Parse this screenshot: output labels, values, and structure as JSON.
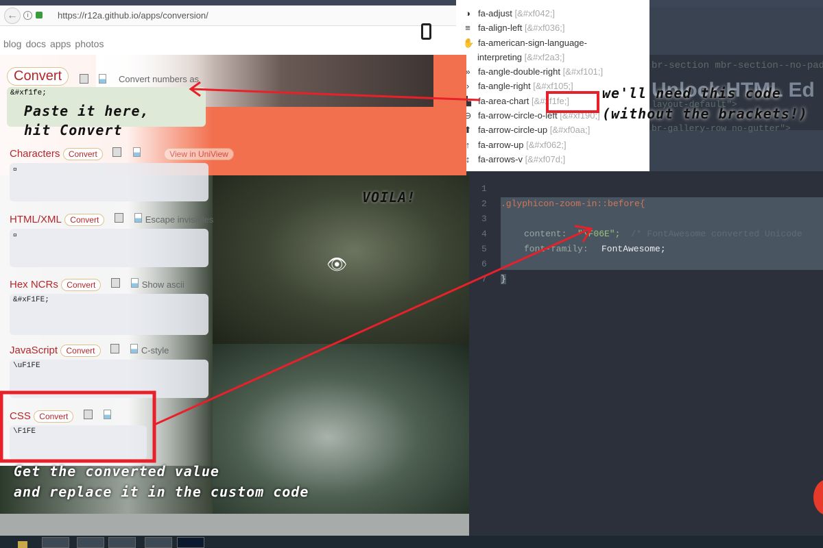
{
  "browser": {
    "url": "https://r12a.github.io/apps/conversion/"
  },
  "nav": [
    "blog",
    "docs",
    "apps",
    "photos"
  ],
  "top_convert": {
    "label": "Convert",
    "option": "Convert numbers as",
    "input_value": "&#xf1fe;"
  },
  "sections": [
    {
      "title": "Characters",
      "button": "Convert",
      "option": "View in UniView",
      "value": ""
    },
    {
      "title": "HTML/XML",
      "button": "Convert",
      "option": "Escape invisibles",
      "value": ""
    },
    {
      "title": "Hex NCRs",
      "button": "Convert",
      "option": "Show ascii",
      "value": "&#xF1FE;"
    },
    {
      "title": "JavaScript",
      "button": "Convert",
      "option": "C-style",
      "value": "\\uF1FE"
    },
    {
      "title": "CSS",
      "button": "Convert",
      "option": "",
      "value": "\\F1FE"
    }
  ],
  "icon_list": [
    {
      "icon": "adjust-icon",
      "glyph": "◑",
      "name": "fa-adjust",
      "code": "[&#xf042;]"
    },
    {
      "icon": "align-left-icon",
      "glyph": "≡",
      "name": "fa-align-left",
      "code": "[&#xf036;]"
    },
    {
      "icon": "sign-language-icon",
      "glyph": "✋",
      "name": "fa-american-sign-language-",
      "name2": "interpreting",
      "code": "[&#xf2a3;]"
    },
    {
      "icon": "angle-double-right-icon",
      "glyph": "»",
      "name": "fa-angle-double-right",
      "code": "[&#xf101;]"
    },
    {
      "icon": "angle-right-icon",
      "glyph": "›",
      "name": "fa-angle-right",
      "code": "[&#xf105;]"
    },
    {
      "icon": "area-chart-icon",
      "glyph": "▙",
      "name": "fa-area-chart",
      "code": "[&#xf1fe;]"
    },
    {
      "icon": "arrow-circle-o-left-icon",
      "glyph": "⊖",
      "name": "fa-arrow-circle-o-left",
      "code": "[&#xf190;]"
    },
    {
      "icon": "arrow-circle-up-icon",
      "glyph": "⬆",
      "name": "fa-arrow-circle-up",
      "code": "[&#xf0aa;]"
    },
    {
      "icon": "arrow-up-icon",
      "glyph": "↑",
      "name": "fa-arrow-up",
      "code": "[&#xf062;]"
    },
    {
      "icon": "arrows-v-icon",
      "glyph": "↕",
      "name": "fa-arrows-v",
      "code": "[&#xf07d;]"
    }
  ],
  "editor": {
    "bg_text": [
      "br-section mbr-section--no-padding",
      "Unlock HTML Ed",
      "layout-default\">",
      "br-gallery-row no-gutter\">"
    ],
    "line_numbers": [
      "1",
      "2",
      "3",
      "4",
      "5",
      "6",
      "7"
    ],
    "selector": ".glyphicon-zoom-in::before{",
    "prop1": "content:",
    "val1": "\"\\F06E\";",
    "comment": "/* FontAwesome converted Unicode",
    "prop2": "font-family:",
    "val2": "FontAwesome;",
    "close": "}"
  },
  "annotations": {
    "paste": "Paste it here,",
    "hit": "hit Convert",
    "need": "we'll need this code",
    "brackets": "(without the brackets!)",
    "voila": "VOILA!",
    "get": "Get the converted value",
    "replace": "and replace it in the custom code"
  },
  "colors": {
    "accent": "#b5262b",
    "orange": "#f2704e",
    "annotation_red": "#e8202a",
    "editor_bg": "#2b303b"
  }
}
